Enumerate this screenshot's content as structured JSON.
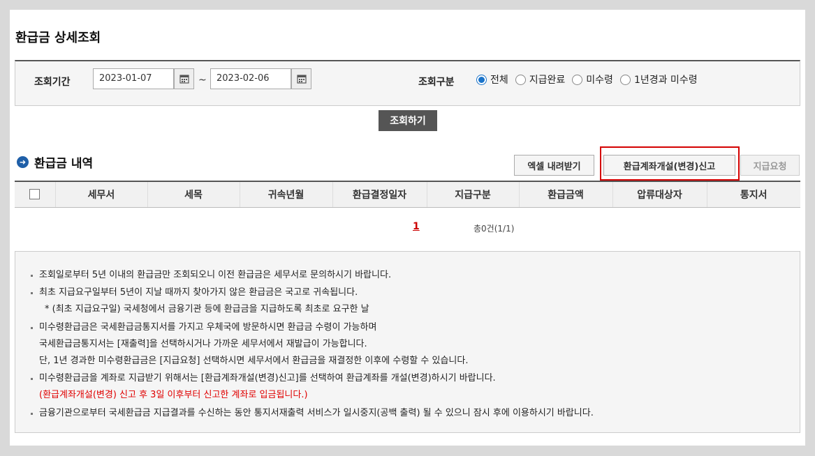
{
  "page": {
    "title": "환급금 상세조회"
  },
  "search": {
    "period_label": "조회기간",
    "date_from": "2023-01-07",
    "date_to": "2023-02-06",
    "tilde": "~",
    "type_label": "조회구분",
    "options": [
      "전체",
      "지급완료",
      "미수령",
      "1년경과 미수령"
    ],
    "selected": "전체",
    "query_button": "조회하기"
  },
  "section": {
    "title": "환급금 내역",
    "buttons": {
      "excel": "엑셀 내려받기",
      "account": "환급계좌개설(변경)신고",
      "request": "지급요청"
    }
  },
  "table": {
    "columns": [
      "세무서",
      "세목",
      "귀속년월",
      "환급결정일자",
      "지급구분",
      "환급금액",
      "압류대상자",
      "통지서"
    ]
  },
  "pagination": {
    "page": "1",
    "total": "총0건(1/1)"
  },
  "notice": {
    "line1": "조회일로부터 5년 이내의 환급금만 조회되오니 이전 환급금은 세무서로 문의하시기 바랍니다.",
    "line2a": "최초 지급요구일부터 5년이 지날 때까지 찾아가지 않은 환급금은 국고로 귀속됩니다.",
    "line2b": "* (최초 지급요구일) 국세청에서 금융기관 등에 환급금을 지급하도록 최초로 요구한 날",
    "line3a": "미수령환급금은 국세환급금통지서를 가지고 우체국에 방문하시면 환급금 수령이 가능하며",
    "line3b": "국세환급금통지서는 [재출력]을 선택하시거나 가까운 세무서에서 재발급이 가능합니다.",
    "line3c": "단, 1년 경과한 미수령환급금은 [지급요청] 선택하시면 세무서에서 환급금을 재결정한 이후에 수령할 수 있습니다.",
    "line4a": "미수령환급금을 계좌로 지급받기 위해서는 [환급계좌개설(변경)신고]를 선택하여 환급계좌를 개설(변경)하시기 바랍니다.",
    "line4b": "(환급계좌개설(변경) 신고 후 3일 이후부터 신고한 계좌로 입금됩니다.)",
    "line5": "금융기관으로부터 국세환급금 지급결과를 수신하는 동안 통지서재출력 서비스가 일시중지(공백 출력) 될 수 있으니 잠시 후에 이용하시기 바랍니다."
  },
  "colors": {
    "accent_blue": "#1a73c9",
    "highlight_red": "#d40000",
    "notice_red": "#e00000"
  }
}
